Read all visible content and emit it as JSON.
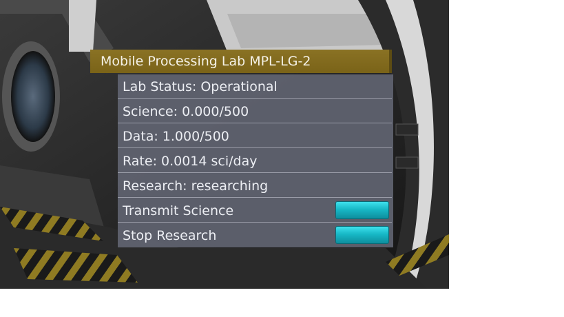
{
  "window": {
    "title": "Mobile Processing Lab MPL-LG-2"
  },
  "rows": [
    {
      "label": "Lab Status: Operational"
    },
    {
      "label": "Science: 0.000/500"
    },
    {
      "label": "Data: 1.000/500"
    },
    {
      "label": "Rate: 0.0014 sci/day"
    },
    {
      "label": "Research: researching"
    },
    {
      "label": "Transmit Science",
      "button": "action"
    },
    {
      "label": "Stop Research",
      "button": "action"
    }
  ],
  "colors": {
    "header": "#7a6318",
    "panel": "#60636f",
    "button": "#17b8c6"
  }
}
